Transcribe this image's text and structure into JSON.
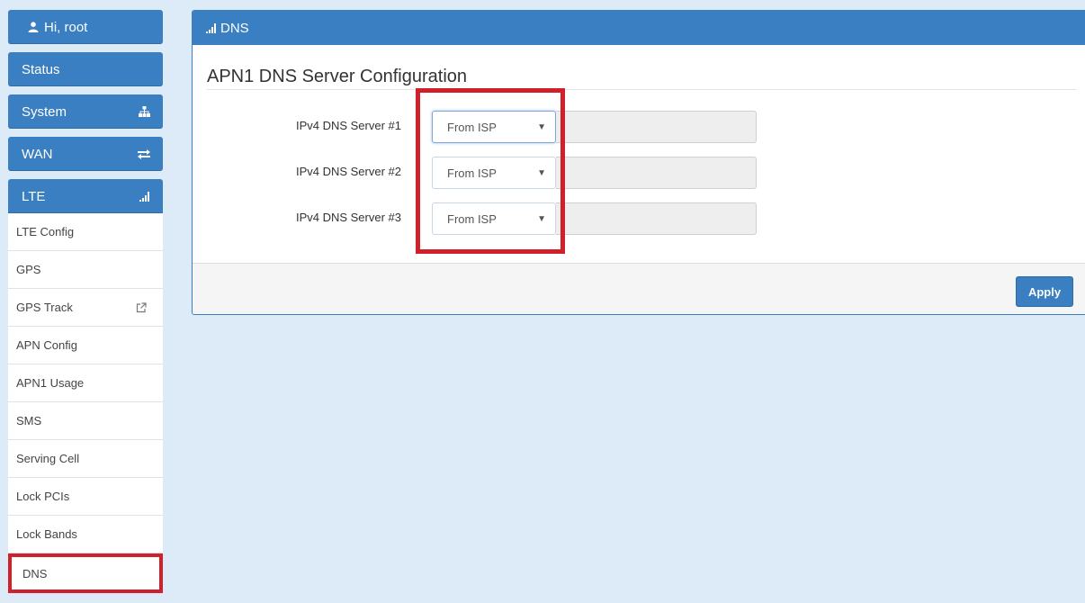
{
  "sidebar": {
    "user_label": "Hi, root",
    "sections": [
      {
        "label": "Status",
        "icon": ""
      },
      {
        "label": "System",
        "icon": "sitemap-icon"
      },
      {
        "label": "WAN",
        "icon": "exchange-arrows-icon"
      }
    ],
    "lte": {
      "label": "LTE",
      "icon": "signal-bars-icon"
    },
    "items": [
      {
        "label": "LTE Config"
      },
      {
        "label": "GPS"
      },
      {
        "label": "GPS Track",
        "icon": "external-link-icon"
      },
      {
        "label": "APN Config"
      },
      {
        "label": "APN1 Usage"
      },
      {
        "label": "SMS"
      },
      {
        "label": "Serving Cell"
      },
      {
        "label": "Lock PCIs"
      },
      {
        "label": "Lock Bands"
      },
      {
        "label": "DNS",
        "active": true
      }
    ]
  },
  "panel": {
    "header_title": "DNS",
    "section_title": "APN1 DNS Server Configuration",
    "rows": [
      {
        "label": "IPv4 DNS Server #1",
        "select_value": "From ISP",
        "input_value": ""
      },
      {
        "label": "IPv4 DNS Server #2",
        "select_value": "From ISP",
        "input_value": ""
      },
      {
        "label": "IPv4 DNS Server #3",
        "select_value": "From ISP",
        "input_value": ""
      }
    ],
    "apply_label": "Apply"
  },
  "colors": {
    "primary": "#3a7fc1",
    "highlight": "#d0202a",
    "page_background": "#ddeaf8"
  }
}
